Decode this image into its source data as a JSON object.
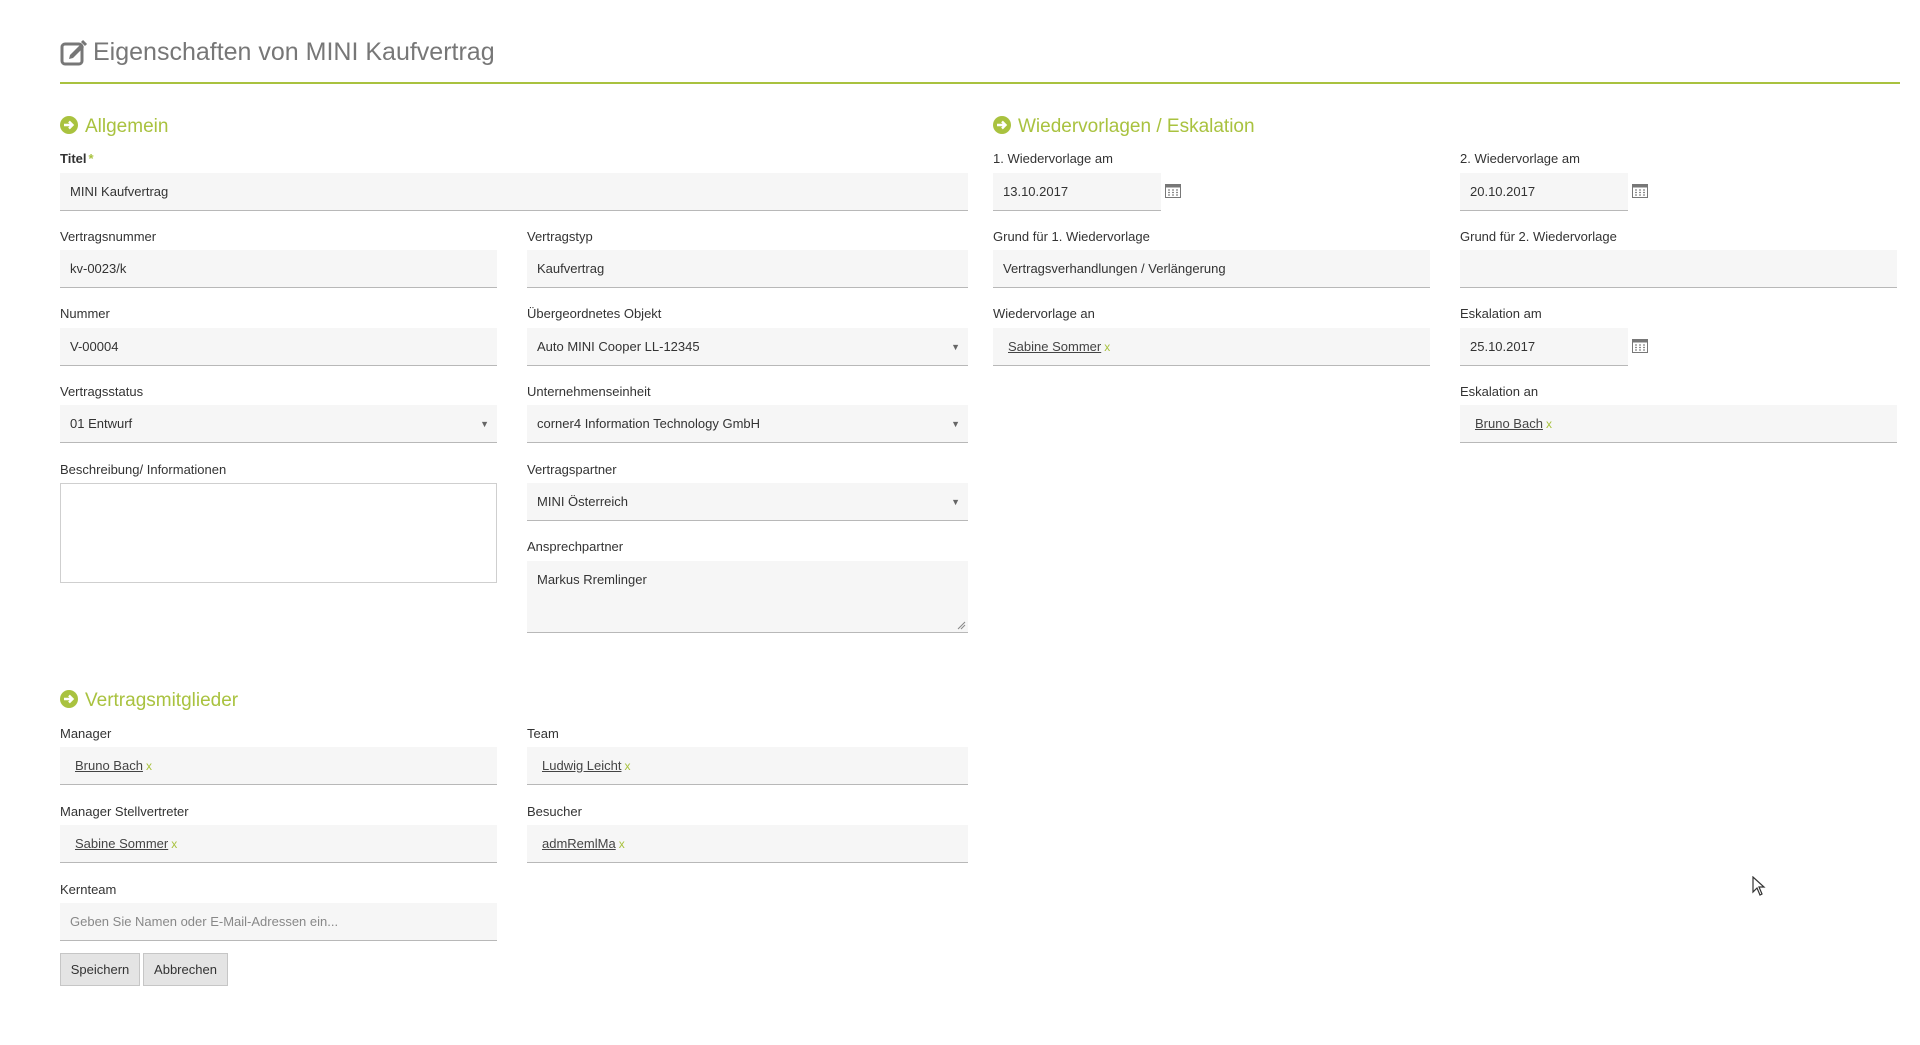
{
  "page": {
    "title": "Eigenschaften von MINI Kaufvertrag"
  },
  "general": {
    "heading": "Allgemein",
    "titel_label": "Titel",
    "titel_required": "*",
    "titel_value": "MINI Kaufvertrag",
    "vertragsnummer_label": "Vertragsnummer",
    "vertragsnummer_value": "kv-0023/k",
    "vertragstyp_label": "Vertragstyp",
    "vertragstyp_value": "Kaufvertrag",
    "nummer_label": "Nummer",
    "nummer_value": "V-00004",
    "uebergeordnet_label": "Übergeordnetes Objekt",
    "uebergeordnet_value": "Auto MINI Cooper LL-12345",
    "vertragsstatus_label": "Vertragsstatus",
    "vertragsstatus_value": "01 Entwurf",
    "unternehmenseinheit_label": "Unternehmenseinheit",
    "unternehmenseinheit_value": "corner4 Information Technology GmbH",
    "beschreibung_label": "Beschreibung/ Informationen",
    "beschreibung_value": "",
    "vertragspartner_label": "Vertragspartner",
    "vertragspartner_value": "MINI Österreich",
    "ansprechpartner_label": "Ansprechpartner",
    "ansprechpartner_value": "Markus Rremlinger"
  },
  "followup": {
    "heading": "Wiedervorlagen / Eskalation",
    "wv1_label": "1. Wiedervorlage am",
    "wv1_value": "13.10.2017",
    "wv2_label": "2. Wiedervorlage am",
    "wv2_value": "20.10.2017",
    "grund1_label": "Grund für 1. Wiedervorlage",
    "grund1_value": "Vertragsverhandlungen / Verlängerung",
    "grund2_label": "Grund für 2. Wiedervorlage",
    "grund2_value": "",
    "wv_an_label": "Wiedervorlage an",
    "wv_an_person": "Sabine Sommer",
    "eskalation_am_label": "Eskalation am",
    "eskalation_am_value": "25.10.2017",
    "eskalation_an_label": "Eskalation an",
    "eskalation_an_person": "Bruno Bach",
    "remove_glyph": "x"
  },
  "members": {
    "heading": "Vertragsmitglieder",
    "manager_label": "Manager",
    "manager_person": "Bruno Bach",
    "team_label": "Team",
    "team_person": "Ludwig Leicht",
    "stellvertreter_label": "Manager Stellvertreter",
    "stellvertreter_person": "Sabine Sommer",
    "besucher_label": "Besucher",
    "besucher_person": "admRemlMa",
    "kernteam_label": "Kernteam",
    "kernteam_placeholder": "Geben Sie Namen oder E-Mail-Adressen ein...",
    "remove_glyph": "x"
  },
  "actions": {
    "save": "Speichern",
    "cancel": "Abbrechen"
  },
  "icons": {
    "caret": "▼"
  },
  "colors": {
    "accent": "#a9c23f"
  }
}
